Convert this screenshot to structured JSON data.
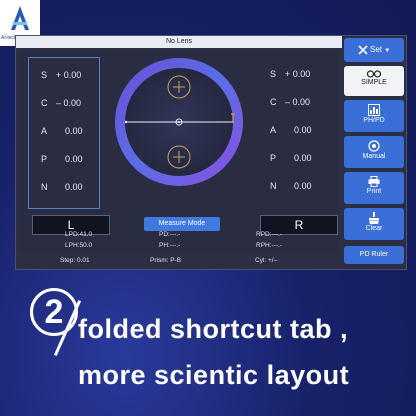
{
  "brand": {
    "text": "AI-tech"
  },
  "title": "No Lens",
  "left_lens": {
    "rows": [
      {
        "label": "S",
        "value": "+ 0.00"
      },
      {
        "label": "C",
        "value": "– 0.00"
      },
      {
        "label": "A",
        "value": "0.00"
      },
      {
        "label": "P",
        "value": "0.00"
      },
      {
        "label": "N",
        "value": "0.00"
      }
    ],
    "button": "L"
  },
  "right_lens": {
    "rows": [
      {
        "label": "S",
        "value": "+ 0.00"
      },
      {
        "label": "C",
        "value": "– 0.00"
      },
      {
        "label": "A",
        "value": "0.00"
      },
      {
        "label": "P",
        "value": "0.00"
      },
      {
        "label": "N",
        "value": "0.00"
      }
    ],
    "button": "R"
  },
  "measure_mode": "Measure Mode",
  "readouts": {
    "lpd": "LPD:41.0",
    "lph": "LPH:50.0",
    "pd": "PD:---.-",
    "ph": "PH:---.-",
    "rpd": "RPD:---.-",
    "rph": "RPH:---.-"
  },
  "status": {
    "step": "Step: 0.01",
    "prism": "Prism: P-B",
    "cyl": "Cyl: +/–"
  },
  "sidebar": {
    "set": "Set",
    "simple": "SIMPLE",
    "phpd": "PH/PD",
    "manual": "Manual",
    "print": "Print",
    "clear": "Clear",
    "pd_ruler": "PD Ruler"
  },
  "headline": {
    "number": "2",
    "line1": "folded shortcut tab ,",
    "line2": "more scientic layout"
  },
  "colors": {
    "accent_blue": "#3b6fd8",
    "ring_purple": "#7b55d8",
    "ring_blue": "#3a7de6"
  }
}
